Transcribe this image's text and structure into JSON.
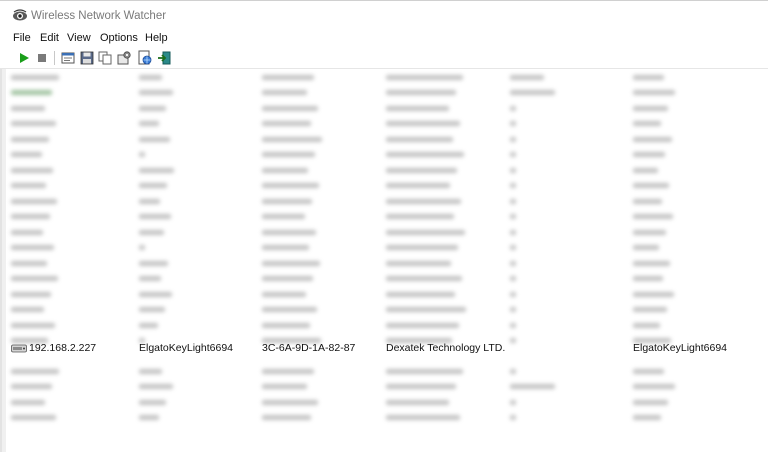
{
  "window": {
    "title": "Wireless Network Watcher"
  },
  "menu": [
    "File",
    "Edit",
    "View",
    "Options",
    "Help"
  ],
  "toolbar": {
    "icons": [
      "play-icon",
      "stop-icon",
      "properties-icon",
      "save-icon",
      "copy-icon",
      "options-icon",
      "html-report-icon",
      "exit-icon"
    ]
  },
  "selected_device": {
    "ip": "192.168.2.227",
    "device_name": "ElgatoKeyLight6694",
    "mac": "3C-6A-9D-1A-82-87",
    "adapter_company": "Dexatek Technology LTD.",
    "device_information": "",
    "user_text": "ElgatoKeyLight6694"
  },
  "colors": {
    "text": "#111111",
    "blurred_text": "#9a9a9a",
    "title_text": "#7a7a7a",
    "play": "#1a9e1a"
  }
}
